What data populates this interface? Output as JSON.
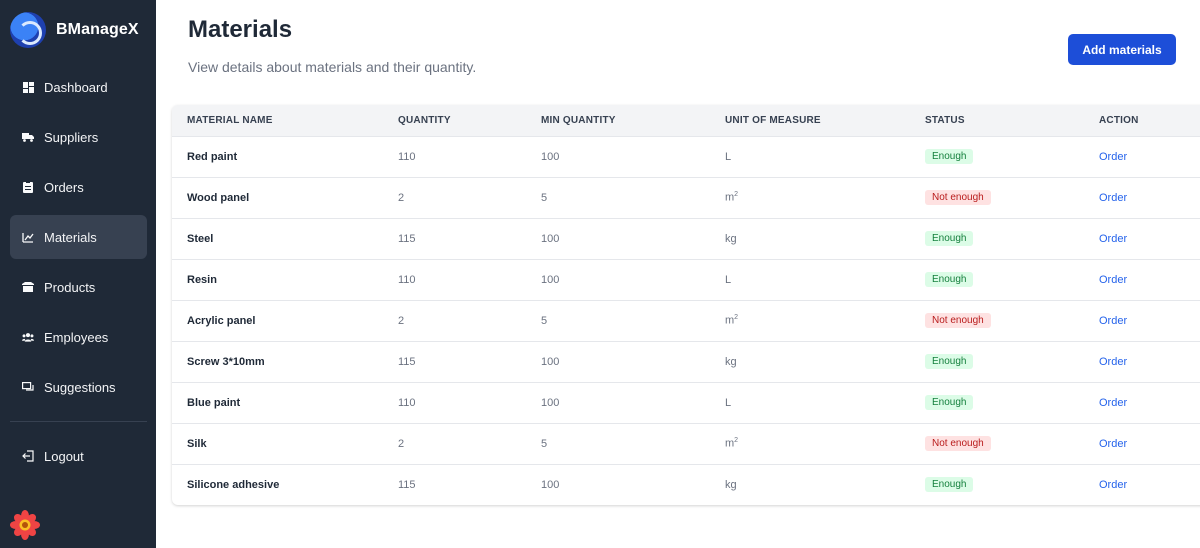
{
  "brand": {
    "name": "BManageX"
  },
  "sidebar": {
    "items": [
      {
        "label": "Dashboard",
        "icon": "dashboard-icon"
      },
      {
        "label": "Suppliers",
        "icon": "truck-icon"
      },
      {
        "label": "Orders",
        "icon": "clipboard-icon"
      },
      {
        "label": "Materials",
        "icon": "materials-icon",
        "active": true
      },
      {
        "label": "Products",
        "icon": "box-icon"
      },
      {
        "label": "Employees",
        "icon": "users-icon"
      },
      {
        "label": "Suggestions",
        "icon": "chat-icon"
      }
    ],
    "logout": {
      "label": "Logout",
      "icon": "logout-icon"
    }
  },
  "header": {
    "title": "Materials",
    "subtitle": "View details about materials and their quantity.",
    "add_button": "Add materials"
  },
  "table": {
    "columns": [
      "MATERIAL NAME",
      "QUANTITY",
      "MIN QUANTITY",
      "UNIT OF MEASURE",
      "STATUS",
      "ACTION"
    ],
    "rows": [
      {
        "name": "Red paint",
        "quantity": "110",
        "min": "100",
        "unit": "L",
        "status": "Enough",
        "action": "Order"
      },
      {
        "name": "Wood panel",
        "quantity": "2",
        "min": "5",
        "unit": "m",
        "unit_sup": "2",
        "status": "Not enough",
        "action": "Order"
      },
      {
        "name": "Steel",
        "quantity": "115",
        "min": "100",
        "unit": "kg",
        "status": "Enough",
        "action": "Order"
      },
      {
        "name": "Resin",
        "quantity": "110",
        "min": "100",
        "unit": "L",
        "status": "Enough",
        "action": "Order"
      },
      {
        "name": "Acrylic panel",
        "quantity": "2",
        "min": "5",
        "unit": "m",
        "unit_sup": "2",
        "status": "Not enough",
        "action": "Order"
      },
      {
        "name": "Screw 3*10mm",
        "quantity": "115",
        "min": "100",
        "unit": "kg",
        "status": "Enough",
        "action": "Order"
      },
      {
        "name": "Blue paint",
        "quantity": "110",
        "min": "100",
        "unit": "L",
        "status": "Enough",
        "action": "Order"
      },
      {
        "name": "Silk",
        "quantity": "2",
        "min": "5",
        "unit": "m",
        "unit_sup": "2",
        "status": "Not enough",
        "action": "Order"
      },
      {
        "name": "Silicone adhesive",
        "quantity": "115",
        "min": "100",
        "unit": "kg",
        "status": "Enough",
        "action": "Order"
      }
    ]
  },
  "colors": {
    "sidebar_bg": "#1f2937",
    "accent": "#1d4ed8",
    "status_ok_bg": "#dcfce7",
    "status_ok_text": "#15803d",
    "status_bad_bg": "#fee2e2",
    "status_bad_text": "#b91c1c"
  }
}
